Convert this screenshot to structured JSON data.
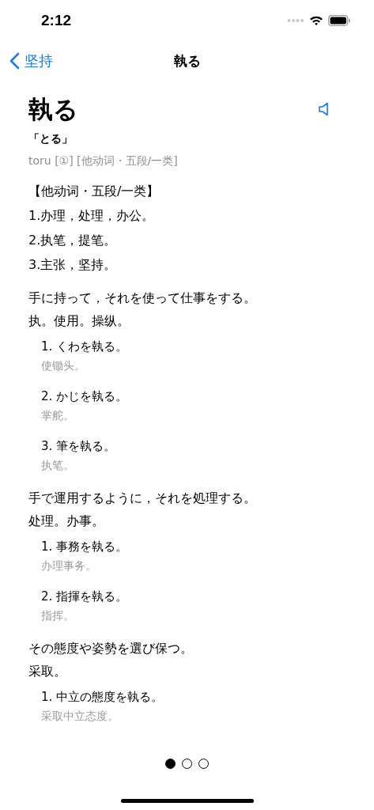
{
  "status_bar": {
    "time": "2:12"
  },
  "nav": {
    "back": "坚持",
    "title": "執る"
  },
  "entry": {
    "headword": "執る",
    "reading": "「とる」",
    "pronunciation": "toru [①] [他动词・五段/一类]",
    "pos_heading": "【他动词・五段/一类】",
    "meanings": [
      "1.办理，处理，办公。",
      "2.执笔，提笔。",
      "3.主张，坚持。"
    ],
    "senses": [
      {
        "definition": "手に持って，それを使って仕事をする。",
        "translation": "执。使用。操纵。",
        "examples": [
          {
            "sentence": "1. くわを執る。",
            "translation": "使锄头。"
          },
          {
            "sentence": "2. かじを執る。",
            "translation": "掌舵。"
          },
          {
            "sentence": "3. 筆を執る。",
            "translation": "执笔。"
          }
        ]
      },
      {
        "definition": "手で運用するように，それを処理する。",
        "translation": "处理。办事。",
        "examples": [
          {
            "sentence": "1. 事務を執る。",
            "translation": "办理事务。"
          },
          {
            "sentence": "2. 指揮を執る。",
            "translation": "指挥。"
          }
        ]
      },
      {
        "definition": "その態度や姿勢を選び保つ。",
        "translation": "采取。",
        "examples": [
          {
            "sentence": "1. 中立の態度を執る。",
            "translation": "采取中立态度。"
          }
        ]
      }
    ]
  },
  "page_dots": [
    {
      "selected": true
    },
    {
      "selected": false
    },
    {
      "selected": false
    }
  ]
}
